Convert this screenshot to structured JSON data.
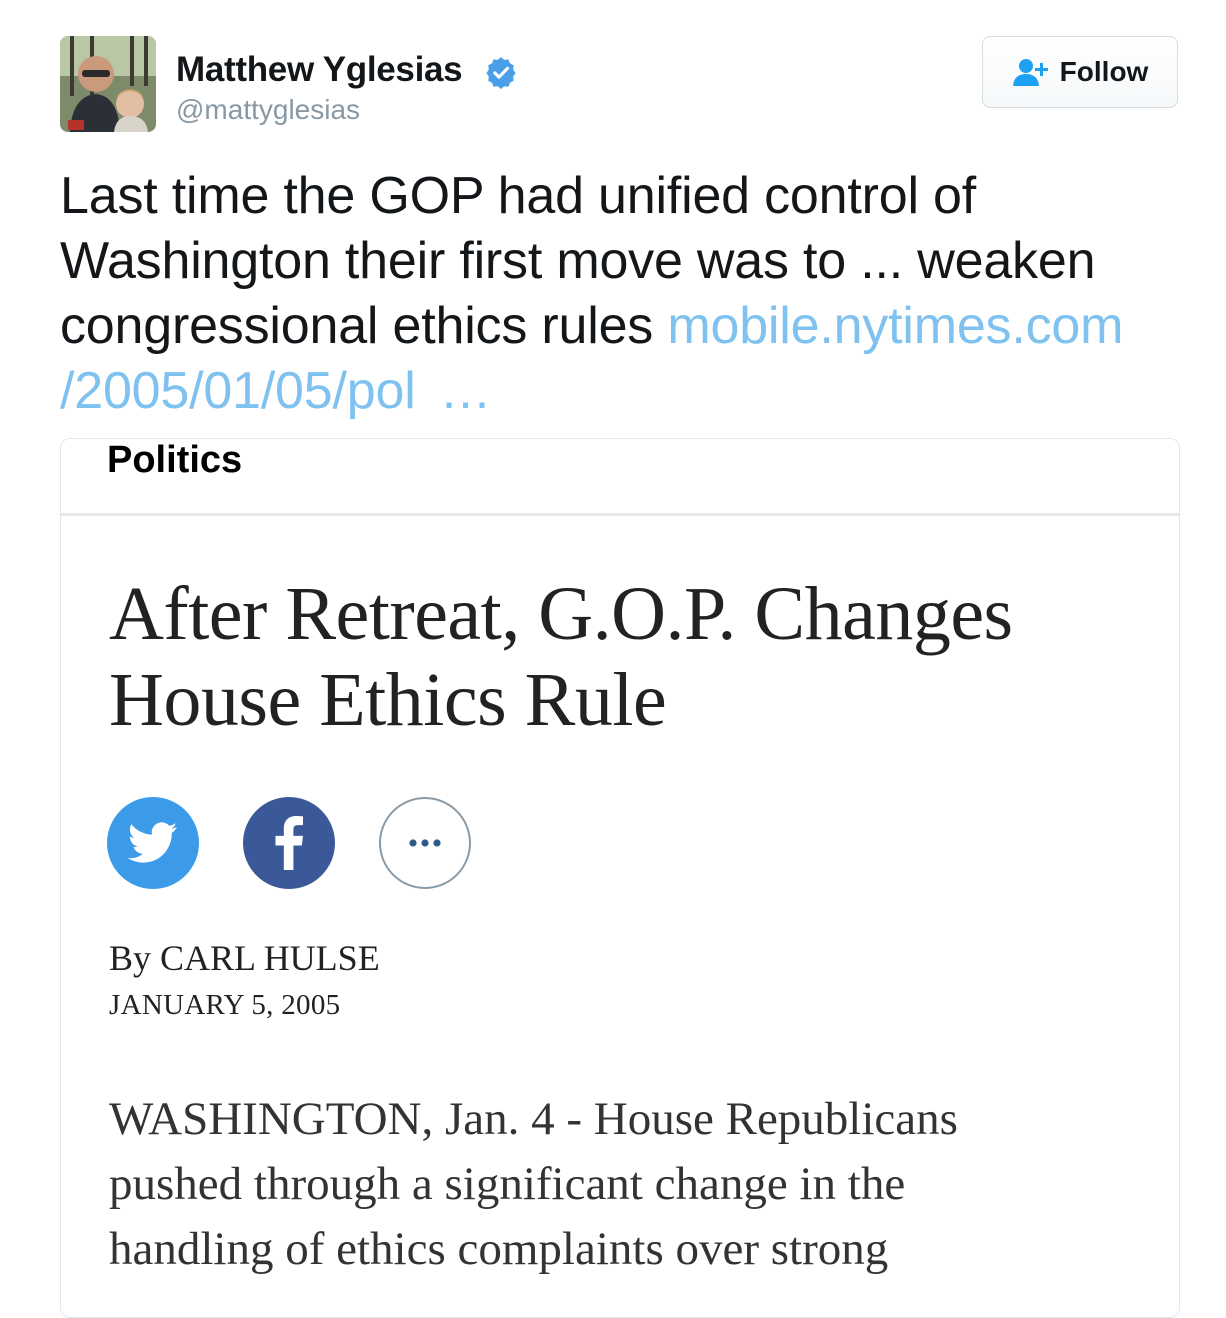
{
  "tweet": {
    "author": {
      "display_name": "Matthew Yglesias",
      "handle": "@mattyglesias",
      "verified": true,
      "avatar_icon": "profile-photo"
    },
    "follow_button": {
      "label": "Follow",
      "icon": "add-user-icon"
    },
    "text_lines": [
      "Last time the GOP had unified control of",
      "Washington their first move was to ... weaken",
      "congressional ethics rules "
    ],
    "link": {
      "line1": "mobile.nytimes.com",
      "line2": "/2005/01/05/pol",
      "ellipsis": "…"
    }
  },
  "card": {
    "section": "Politics",
    "headline": "After Retreat, G.O.P. Changes\nHouse Ethics Rule",
    "share_buttons": [
      {
        "name": "twitter",
        "icon": "twitter-bird-icon"
      },
      {
        "name": "facebook",
        "icon": "facebook-f-icon"
      },
      {
        "name": "more",
        "icon": "more-dots-icon"
      }
    ],
    "byline": "By CARL HULSE",
    "date": "JANUARY 5, 2005",
    "body_lines": [
      "WASHINGTON, Jan. 4 - House Republicans",
      "pushed through a significant change in the",
      "handling of ethics complaints over strong"
    ]
  },
  "colors": {
    "link": "#7fc2f0",
    "verified_badge": "#4aa0e8",
    "twitter_blue": "#3b9be9",
    "facebook_blue": "#3b5998",
    "handle_gray": "#8899a6"
  }
}
